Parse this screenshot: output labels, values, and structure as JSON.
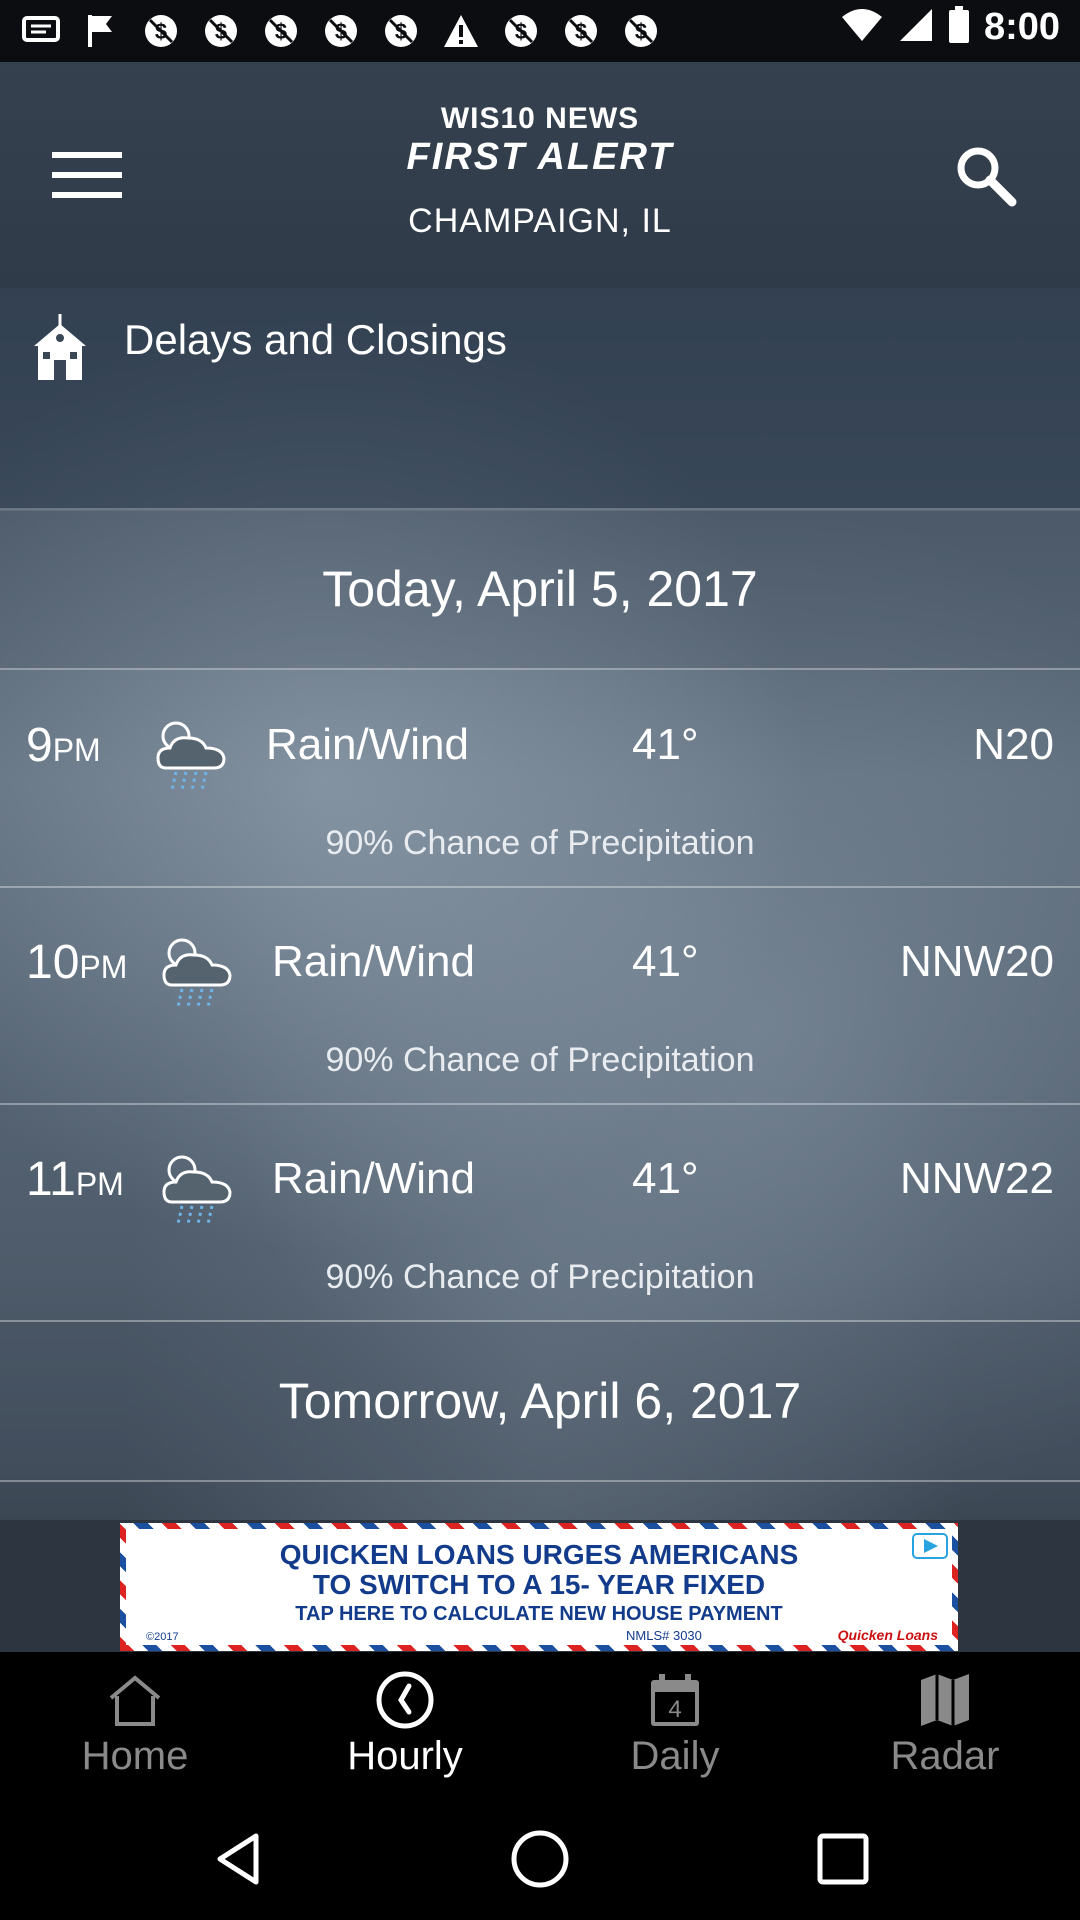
{
  "status_bar": {
    "time": "8:00",
    "notification_icons": [
      "message-icon",
      "flag-icon",
      "no-money-icon",
      "no-money-icon",
      "no-money-icon",
      "no-money-icon",
      "no-money-icon",
      "alert-icon",
      "no-money-icon",
      "no-money-icon",
      "no-money-icon"
    ],
    "right_icons": [
      "wifi-icon",
      "signal-icon",
      "battery-icon"
    ]
  },
  "header": {
    "logo_top": "WIS10 NEWS",
    "logo_main": "FIRST ALERT",
    "location": "CHAMPAIGN, IL"
  },
  "delays": {
    "label": "Delays and Closings"
  },
  "today_header": "Today, April 5, 2017",
  "hours": [
    {
      "time": "9",
      "suffix": "PM",
      "condition": "Rain/Wind",
      "temp": "41°",
      "wind": "N20",
      "precip": "90% Chance of Precipitation"
    },
    {
      "time": "10",
      "suffix": "PM",
      "condition": "Rain/Wind",
      "temp": "41°",
      "wind": "NNW20",
      "precip": "90% Chance of Precipitation"
    },
    {
      "time": "11",
      "suffix": "PM",
      "condition": "Rain/Wind",
      "temp": "41°",
      "wind": "NNW22",
      "precip": "90% Chance of Precipitation"
    }
  ],
  "tomorrow_header": "Tomorrow, April 6, 2017",
  "ad": {
    "line1": "QUICKEN LOANS URGES AMERICANS",
    "line2": "TO SWITCH TO A 15- YEAR FIXED",
    "line3": "TAP HERE TO CALCULATE NEW HOUSE PAYMENT",
    "footnote": "©2017",
    "nmls": "NMLS# 3030",
    "brand": "Quicken Loans"
  },
  "tabs": [
    {
      "label": "Home",
      "icon": "home-icon",
      "active": false
    },
    {
      "label": "Hourly",
      "icon": "clock-icon",
      "active": true
    },
    {
      "label": "Daily",
      "icon": "calendar-icon",
      "active": false,
      "badge": "4"
    },
    {
      "label": "Radar",
      "icon": "map-icon",
      "active": false
    }
  ],
  "colors": {
    "header_bg": "#333e4c",
    "active_tab": "#ffffff",
    "inactive_tab": "#8a8a8a",
    "precip_drops": "#6fb5e8"
  }
}
